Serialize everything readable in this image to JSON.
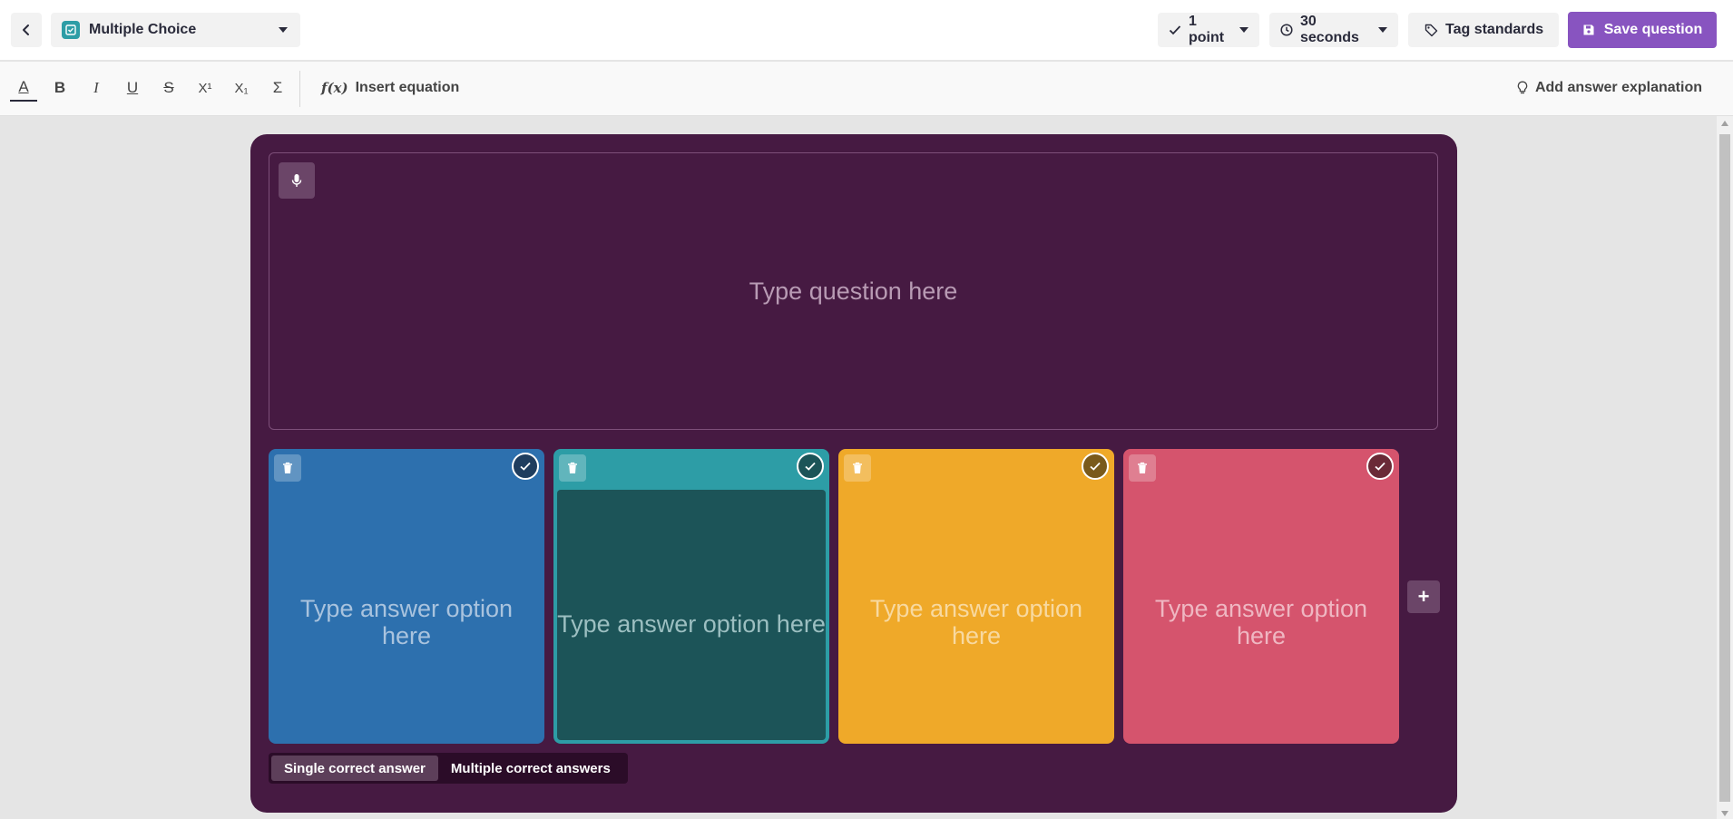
{
  "header": {
    "question_type": "Multiple Choice",
    "points": "1 point",
    "time": "30 seconds",
    "tag_standards": "Tag standards",
    "save": "Save question"
  },
  "toolbar": {
    "text_color": "A",
    "bold": "B",
    "italic": "I",
    "underline": "U",
    "strikethrough": "S",
    "superscript": "X¹",
    "subscript": "X₁",
    "sigma": "Σ",
    "insert_equation": "Insert equation",
    "equation_icon": "f(x)",
    "add_explanation": "Add answer explanation"
  },
  "question": {
    "placeholder": "Type question here"
  },
  "options": [
    {
      "placeholder": "Type answer option here",
      "color": "#2d70ae"
    },
    {
      "placeholder": "Type answer option here",
      "color": "#2d9da6"
    },
    {
      "placeholder": "Type answer option here",
      "color": "#efa929"
    },
    {
      "placeholder": "Type answer option here",
      "color": "#d5546d"
    }
  ],
  "add_option": "+",
  "answer_mode": {
    "single": "Single correct answer",
    "multiple": "Multiple correct answers",
    "selected": "single"
  },
  "colors": {
    "editor_bg": "#461a42",
    "accent": "#8854c0"
  }
}
